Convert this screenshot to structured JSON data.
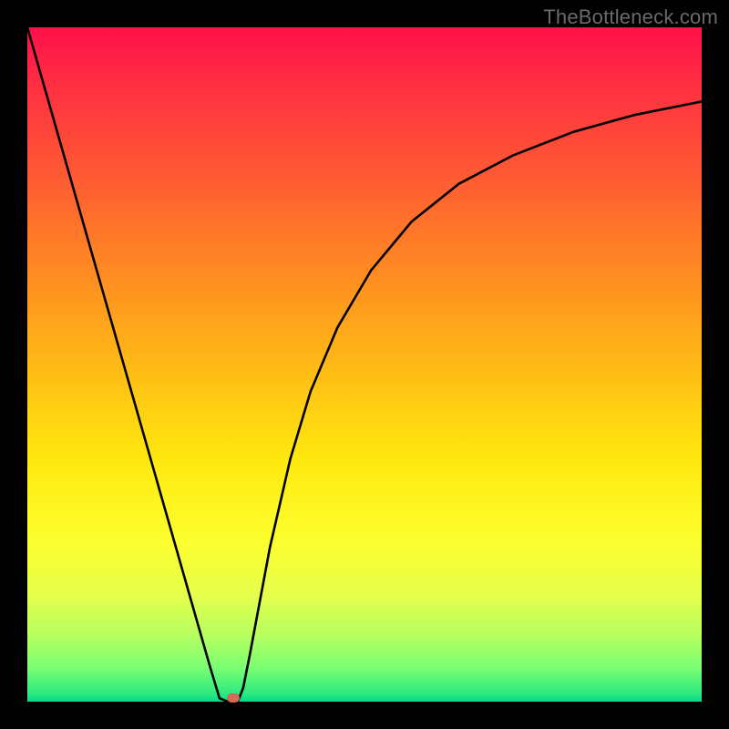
{
  "watermark": "TheBottleneck.com",
  "chart_data": {
    "type": "line",
    "title": "",
    "xlabel": "",
    "ylabel": "",
    "xlim": [
      0,
      1
    ],
    "ylim": [
      0,
      1
    ],
    "series": [
      {
        "name": "curve",
        "x": [
          0.0,
          0.03,
          0.06,
          0.09,
          0.12,
          0.15,
          0.18,
          0.21,
          0.24,
          0.27,
          0.285,
          0.297,
          0.312,
          0.32,
          0.33,
          0.345,
          0.36,
          0.39,
          0.42,
          0.46,
          0.51,
          0.57,
          0.64,
          0.72,
          0.81,
          0.9,
          1.0
        ],
        "y": [
          1.0,
          0.895,
          0.79,
          0.685,
          0.58,
          0.475,
          0.37,
          0.265,
          0.16,
          0.055,
          0.005,
          0.0,
          0.0,
          0.02,
          0.07,
          0.15,
          0.23,
          0.36,
          0.46,
          0.555,
          0.64,
          0.712,
          0.768,
          0.81,
          0.845,
          0.87,
          0.89
        ]
      }
    ],
    "marker": {
      "x": 0.305,
      "y": 0.005
    },
    "colors": {
      "curve": "#000000",
      "marker": "#d66b5a",
      "gradient_top": "#ff1049",
      "gradient_bottom": "#00d88a",
      "frame": "#000000"
    }
  }
}
